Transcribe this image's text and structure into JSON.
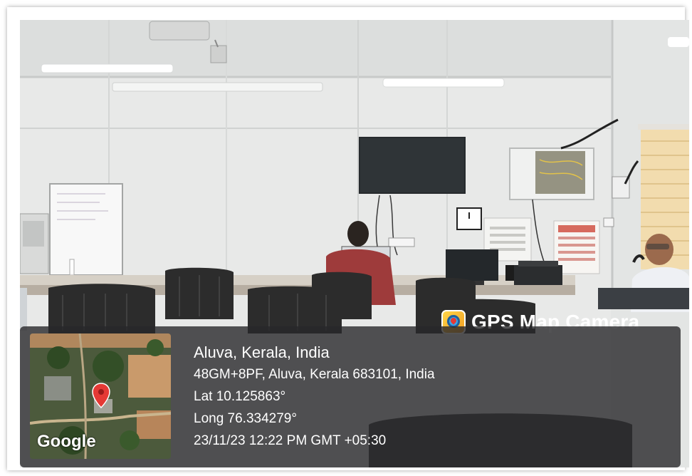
{
  "stamp": {
    "title": "GPS Map Camera",
    "map_logo": "Google",
    "location": "Aluva, Kerala, India",
    "address": "48GM+8PF, Aluva, Kerala 683101, India",
    "latitude": "Lat 10.125863°",
    "longitude": "Long 76.334279°",
    "datetime": "23/11/23 12:22 PM GMT +05:30"
  },
  "icons": {
    "app_icon": "gps-map-camera-icon",
    "map_pin": "map-pin-icon"
  },
  "colors": {
    "overlay": "#28282a",
    "pin": "#e53935",
    "text": "#ffffff"
  }
}
